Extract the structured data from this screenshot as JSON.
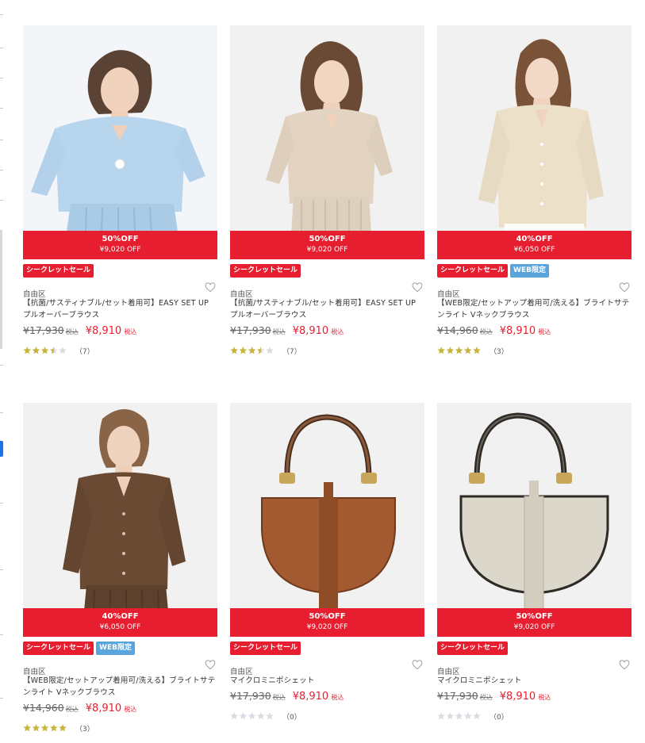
{
  "products": [
    {
      "image": "light-blue-blouse-photo",
      "discount_pct": "50%OFF",
      "discount_amount": "¥9,020 OFF",
      "badges": [
        "シークレットセール"
      ],
      "brand": "自由区",
      "title": "【抗菌/サスティナブル/セット着用可】EASY SET UP プルオーバーブラウス",
      "old_price": "¥17,930",
      "new_price": "¥8,910",
      "tax_label": "税込",
      "rating": 3.5,
      "review_count": "（7）"
    },
    {
      "image": "beige-blouse-photo",
      "discount_pct": "50%OFF",
      "discount_amount": "¥9,020 OFF",
      "badges": [
        "シークレットセール"
      ],
      "brand": "自由区",
      "title": "【抗菌/サスティナブル/セット着用可】EASY SET UP プルオーバーブラウス",
      "old_price": "¥17,930",
      "new_price": "¥8,910",
      "tax_label": "税込",
      "rating": 3.5,
      "review_count": "（7）"
    },
    {
      "image": "cream-vneck-blouse-photo",
      "discount_pct": "40%OFF",
      "discount_amount": "¥6,050 OFF",
      "badges": [
        "シークレットセール",
        "WEB限定"
      ],
      "brand": "自由区",
      "title": "【WEB限定/セットアップ着用可/洗える】ブライトサテンライト Vネックブラウス",
      "old_price": "¥14,960",
      "new_price": "¥8,910",
      "tax_label": "税込",
      "rating": 5,
      "review_count": "（3）"
    },
    {
      "image": "brown-vneck-blouse-photo",
      "discount_pct": "40%OFF",
      "discount_amount": "¥6,050 OFF",
      "badges": [
        "シークレットセール",
        "WEB限定"
      ],
      "brand": "自由区",
      "title": "【WEB限定/セットアップ着用可/洗える】ブライトサテンライト Vネックブラウス",
      "old_price": "¥14,960",
      "new_price": "¥8,910",
      "tax_label": "税込",
      "rating": 5,
      "review_count": "（3）"
    },
    {
      "image": "brown-mini-pochette-photo",
      "discount_pct": "50%OFF",
      "discount_amount": "¥9,020 OFF",
      "badges": [
        "シークレットセール"
      ],
      "brand": "自由区",
      "title": "マイクロミニポシェット",
      "old_price": "¥17,930",
      "new_price": "¥8,910",
      "tax_label": "税込",
      "rating": 0,
      "review_count": "（0）"
    },
    {
      "image": "ivory-mini-pochette-photo",
      "discount_pct": "50%OFF",
      "discount_amount": "¥9,020 OFF",
      "badges": [
        "シークレットセール"
      ],
      "brand": "自由区",
      "title": "マイクロミニポシェット",
      "old_price": "¥17,930",
      "new_price": "¥8,910",
      "tax_label": "税込",
      "rating": 0,
      "review_count": "（0）"
    }
  ],
  "colors": {
    "sale_red": "#e61e2f",
    "web_blue": "#5aa5dc",
    "star_gold": "#c9b43a",
    "star_empty": "#d9dde3"
  }
}
